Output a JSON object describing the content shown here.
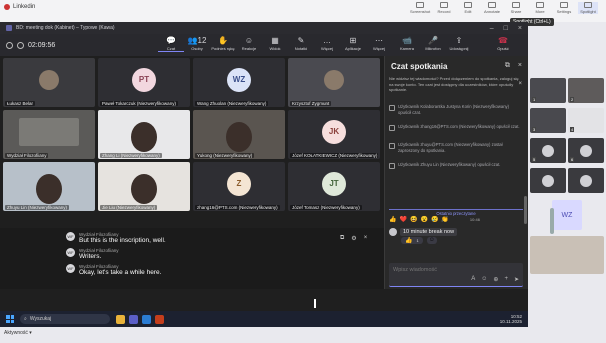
{
  "browser": {
    "tab_title": "Linkedin",
    "tools": [
      "Screenshot",
      "Record",
      "Edit",
      "Annotate",
      "Share",
      "More",
      "Settings",
      "Spotlight"
    ],
    "tooltip": "Spotlight (Ctrl+L)"
  },
  "window": {
    "title": "BD: meeting dok (Kabinet) – Typowe (Kawa)"
  },
  "toolbar": {
    "timer": "02:09:56",
    "tools": [
      {
        "label": "Czat",
        "icon": "chat-icon",
        "glyph": "💬"
      },
      {
        "label": "Osoby",
        "icon": "people-icon",
        "glyph": "👥",
        "count": "12"
      },
      {
        "label": "Podnieś rękę",
        "icon": "raise-hand-icon",
        "glyph": "✋"
      },
      {
        "label": "Reakcje",
        "icon": "reaction-icon",
        "glyph": "☺"
      },
      {
        "label": "Widok",
        "icon": "view-icon",
        "glyph": "▦"
      },
      {
        "label": "Notatki",
        "icon": "notes-icon",
        "glyph": "✎"
      },
      {
        "label": "Więcej",
        "icon": "more-icon",
        "glyph": "…"
      },
      {
        "label": "Aplikacje",
        "icon": "apps-icon",
        "glyph": "⊞"
      },
      {
        "label": "Więcej",
        "icon": "more-icon",
        "glyph": "⋯"
      }
    ],
    "call_tools": [
      {
        "label": "Kamera",
        "icon": "camera-icon",
        "glyph": "📹"
      },
      {
        "label": "Mikrofon",
        "icon": "mic-icon",
        "glyph": "🎤"
      },
      {
        "label": "Udostępnij",
        "icon": "share-icon",
        "glyph": "⇪"
      }
    ],
    "leave_label": "Opuść"
  },
  "tiles": [
    {
      "name": "Łukasz Belar",
      "kind": "photo",
      "bg": "#3a3a3e"
    },
    {
      "name": "Paweł Tokarczuk (Niezweryfikowany)",
      "kind": "avatar",
      "initials": "PT",
      "avbg": "#f2d7df",
      "avfg": "#8a4154"
    },
    {
      "name": "Wang Zhuolan (Niezweryfikowany)",
      "kind": "avatar",
      "initials": "WZ",
      "avbg": "#dbe3f7",
      "avfg": "#3b4f8a"
    },
    {
      "name": "Krzysztof Zygmunt",
      "kind": "photo",
      "bg": "#4a4a50"
    },
    {
      "name": "Wydział Filozofiiany",
      "kind": "room",
      "bg": "#5b5a58"
    },
    {
      "name": "Zhang Li (Niezweryfikowany)",
      "kind": "person",
      "bg": "#e8e8ea"
    },
    {
      "name": "Yukong (Niezweryfikowany)",
      "kind": "person",
      "bg": "#5a5550"
    },
    {
      "name": "Józef KOŁATKIEWICZ (Niezweryfikowany)",
      "kind": "avatar",
      "initials": "JK",
      "avbg": "#f6dedd",
      "avfg": "#8a3f3a"
    },
    {
      "name": "Zhuyu Lin (Niezweryfikowany)",
      "kind": "person",
      "bg": "#b7c0c9"
    },
    {
      "name": "Jie Liu (Niezweryfikowany)",
      "kind": "person",
      "bg": "#e6e3df"
    },
    {
      "name": "zhang16@PTS.com (Niezweryfikowany)",
      "kind": "avatar",
      "initials": "Z",
      "avbg": "#f4e5d3",
      "avfg": "#8b5c2b"
    },
    {
      "name": "Józef Tomasz (Niezweryfikowany)",
      "kind": "avatar",
      "initials": "JT",
      "avbg": "#dfe8d9",
      "avfg": "#43633a"
    }
  ],
  "captions": [
    {
      "who": "Wydział Filozofiiany",
      "text": "But this is the inscription, well."
    },
    {
      "who": "Wydział Filozofiiany",
      "text": "Writers."
    },
    {
      "who": "Wydział Filozofiiany",
      "text": "Okay, let's take a while here."
    }
  ],
  "chat": {
    "title": "Czat spotkania",
    "notice": "Nie widzisz tej wiadomości? Przed dołączeniem do spotkania, zaloguj się na swoje konto. Ten czat jest dostępny dla uczestników, które opuściły spotkanie.",
    "events": [
      "Użytkownik Kolaborantka Justyna Korin (Niezweryfikowany) opuścił czat.",
      "Użytkownik zhang16@PTS.com (Niezweryfikowany) opuścił czat.",
      "Użytkownik zhuyu@PTS.com (Niezweryfikowany) został zaproszony do spotkania.",
      "Użytkownik Zhuyu Lin (Niezweryfikowany) opuścił czat."
    ],
    "unread_label": "Ostatnio przeczytane",
    "reactions": [
      "👍",
      "❤️",
      "😆",
      "😮",
      "😢",
      "👏"
    ],
    "time": "10:46",
    "message": "10 minute break now",
    "message_reactions": [
      "👍",
      "1"
    ],
    "compose_placeholder": "Wpisz wiadomość"
  },
  "taskbar": {
    "search_placeholder": "Wyszukaj",
    "time": "10:52",
    "date": "10.11.2025"
  },
  "footer": {
    "text": "Aktywność ▾"
  },
  "side": {
    "wz_initials": "WZ",
    "numbers": [
      "1",
      "2",
      "3",
      "4",
      "5",
      "6"
    ]
  }
}
